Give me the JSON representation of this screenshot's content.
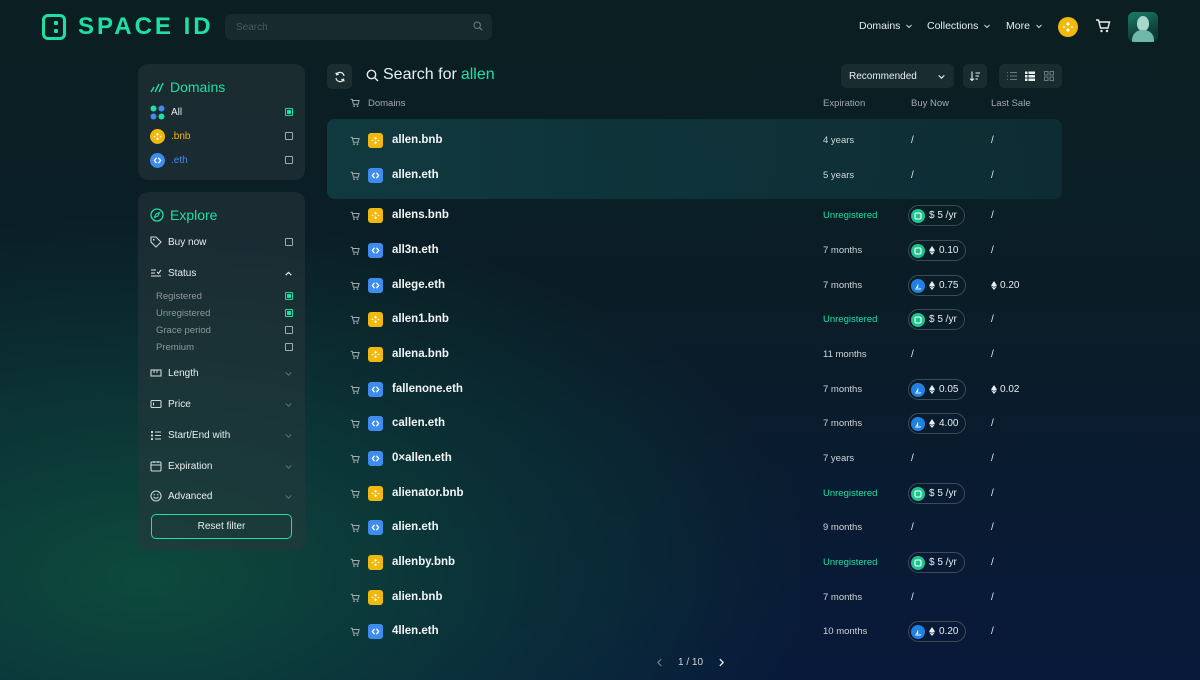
{
  "brand": {
    "name": "SPACE ID",
    "accent": "#1ee0a5"
  },
  "header": {
    "search_placeholder": "Search",
    "nav": [
      "Domains",
      "Collections",
      "More"
    ]
  },
  "sidebar": {
    "domains_title": "Domains",
    "domain_filters": [
      {
        "label": "All",
        "checked": true,
        "icon": "grid-icon"
      },
      {
        "label": ".bnb",
        "checked": false,
        "icon": "bnb-icon",
        "color": "#f0b90b"
      },
      {
        "label": ".eth",
        "checked": false,
        "icon": "eth-icon",
        "color": "#3f8cf0"
      }
    ],
    "explore_title": "Explore",
    "buy_now_label": "Buy now",
    "status_label": "Status",
    "status_options": [
      {
        "label": "Registered",
        "checked": true
      },
      {
        "label": "Unregistered",
        "checked": true
      },
      {
        "label": "Grace period",
        "checked": false
      },
      {
        "label": "Premium",
        "checked": false
      }
    ],
    "filters": [
      "Length",
      "Price",
      "Start/End with",
      "Expiration",
      "Advanced"
    ],
    "reset_label": "Reset filter"
  },
  "main": {
    "search_prefix": "Search for",
    "search_query": "allen",
    "sort_value": "Recommended",
    "columns": {
      "domains": "Domains",
      "expiration": "Expiration",
      "buy_now": "Buy Now",
      "last_sale": "Last Sale"
    },
    "rows": [
      {
        "name": "allen.bnb",
        "tld": "bnb",
        "expiration": "4 years",
        "buy": "/",
        "buy_market": "",
        "last": "/"
      },
      {
        "name": "allen.eth",
        "tld": "eth",
        "expiration": "5 years",
        "buy": "/",
        "buy_market": "",
        "last": "/"
      },
      {
        "name": "allens.bnb",
        "tld": "bnb",
        "expiration": "Unregistered",
        "buy": "$ 5 /yr",
        "buy_market": "spaceid",
        "last": "/"
      },
      {
        "name": "all3n.eth",
        "tld": "eth",
        "expiration": "7 months",
        "buy": "0.10",
        "buy_market": "spaceid",
        "last": "/"
      },
      {
        "name": "allege.eth",
        "tld": "eth",
        "expiration": "7 months",
        "buy": "0.75",
        "buy_market": "opensea",
        "last": "0.20"
      },
      {
        "name": "allen1.bnb",
        "tld": "bnb",
        "expiration": "Unregistered",
        "buy": "$ 5 /yr",
        "buy_market": "spaceid",
        "last": "/"
      },
      {
        "name": "allena.bnb",
        "tld": "bnb",
        "expiration": "11 months",
        "buy": "/",
        "buy_market": "",
        "last": "/"
      },
      {
        "name": "fallenone.eth",
        "tld": "eth",
        "expiration": "7 months",
        "buy": "0.05",
        "buy_market": "opensea",
        "last": "0.02"
      },
      {
        "name": "callen.eth",
        "tld": "eth",
        "expiration": "7 months",
        "buy": "4.00",
        "buy_market": "opensea",
        "last": "/"
      },
      {
        "name": "0×allen.eth",
        "tld": "eth",
        "expiration": "7 years",
        "buy": "/",
        "buy_market": "",
        "last": "/"
      },
      {
        "name": "alienator.bnb",
        "tld": "bnb",
        "expiration": "Unregistered",
        "buy": "$ 5 /yr",
        "buy_market": "spaceid",
        "last": "/"
      },
      {
        "name": "alien.eth",
        "tld": "eth",
        "expiration": "9 months",
        "buy": "/",
        "buy_market": "",
        "last": "/"
      },
      {
        "name": "allenby.bnb",
        "tld": "bnb",
        "expiration": "Unregistered",
        "buy": "$ 5 /yr",
        "buy_market": "spaceid",
        "last": "/"
      },
      {
        "name": "alien.bnb",
        "tld": "bnb",
        "expiration": "7 months",
        "buy": "/",
        "buy_market": "",
        "last": "/"
      },
      {
        "name": "4llen.eth",
        "tld": "eth",
        "expiration": "10 months",
        "buy": "0.20",
        "buy_market": "opensea",
        "last": "/"
      }
    ],
    "pagination": "1 / 10"
  }
}
